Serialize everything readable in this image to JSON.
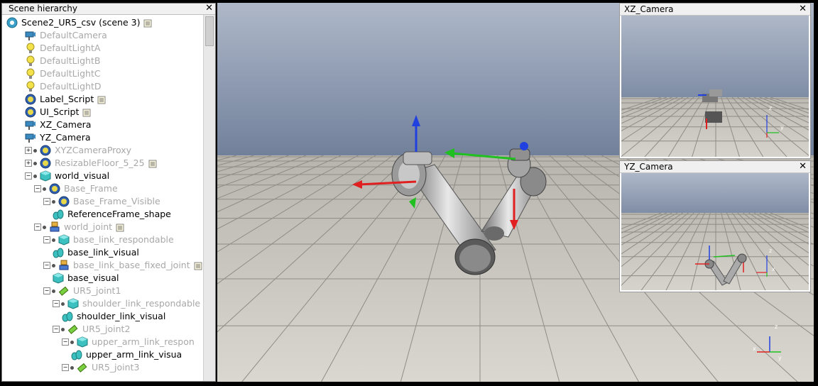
{
  "hierarchy": {
    "title": "Scene hierarchy",
    "close": "✕",
    "items": [
      {
        "label": "Scene2_UR5_csv (scene 3)",
        "icon": "scene-icon",
        "dim": false
      },
      {
        "label": "DefaultCamera",
        "icon": "camera-icon",
        "dim": true
      },
      {
        "label": "DefaultLightA",
        "icon": "light-icon",
        "dim": true
      },
      {
        "label": "DefaultLightB",
        "icon": "light-icon",
        "dim": true
      },
      {
        "label": "DefaultLightC",
        "icon": "light-icon",
        "dim": true
      },
      {
        "label": "DefaultLightD",
        "icon": "light-icon",
        "dim": true
      },
      {
        "label": "Label_Script",
        "icon": "dummy-icon",
        "dim": false
      },
      {
        "label": "UI_Script",
        "icon": "dummy-icon",
        "dim": false
      },
      {
        "label": "XZ_Camera",
        "icon": "camera-icon",
        "dim": false
      },
      {
        "label": "YZ_Camera",
        "icon": "camera-icon",
        "dim": false
      },
      {
        "label": "XYZCameraProxy",
        "icon": "dummy-icon",
        "dim": true
      },
      {
        "label": "ResizableFloor_5_25",
        "icon": "dummy-icon",
        "dim": true
      },
      {
        "label": "world_visual",
        "icon": "shape-icon",
        "dim": false
      },
      {
        "label": "Base_Frame",
        "icon": "dummy-icon",
        "dim": true
      },
      {
        "label": "Base_Frame_Visible",
        "icon": "dummy-icon",
        "dim": true
      },
      {
        "label": "ReferenceFrame_shape",
        "icon": "mesh-icon",
        "dim": false
      },
      {
        "label": "world_joint",
        "icon": "joint-icon",
        "dim": true
      },
      {
        "label": "base_link_respondable",
        "icon": "shape-icon",
        "dim": true
      },
      {
        "label": "base_link_visual",
        "icon": "mesh-icon",
        "dim": false
      },
      {
        "label": "base_link_base_fixed_joint",
        "icon": "joint-icon",
        "dim": true
      },
      {
        "label": "base_visual",
        "icon": "shape-icon",
        "dim": false
      },
      {
        "label": "UR5_joint1",
        "icon": "revolute-icon",
        "dim": true
      },
      {
        "label": "shoulder_link_respondable",
        "icon": "shape-icon",
        "dim": true
      },
      {
        "label": "shoulder_link_visual",
        "icon": "mesh-icon",
        "dim": false
      },
      {
        "label": "UR5_joint2",
        "icon": "revolute-icon",
        "dim": true
      },
      {
        "label": "upper_arm_link_respon",
        "icon": "shape-icon",
        "dim": true
      },
      {
        "label": "upper_arm_link_visua",
        "icon": "mesh-icon",
        "dim": false
      },
      {
        "label": "UR5_joint3",
        "icon": "revolute-icon",
        "dim": true
      }
    ]
  },
  "insets": {
    "xz": {
      "title": "XZ_Camera",
      "close": "✕"
    },
    "yz": {
      "title": "YZ_Camera",
      "close": "✕"
    }
  },
  "axes": {
    "x": "x",
    "y": "y",
    "z": "z"
  },
  "colors": {
    "x_axis": "#e02020",
    "y_axis": "#20c020",
    "z_axis": "#2040e0"
  }
}
